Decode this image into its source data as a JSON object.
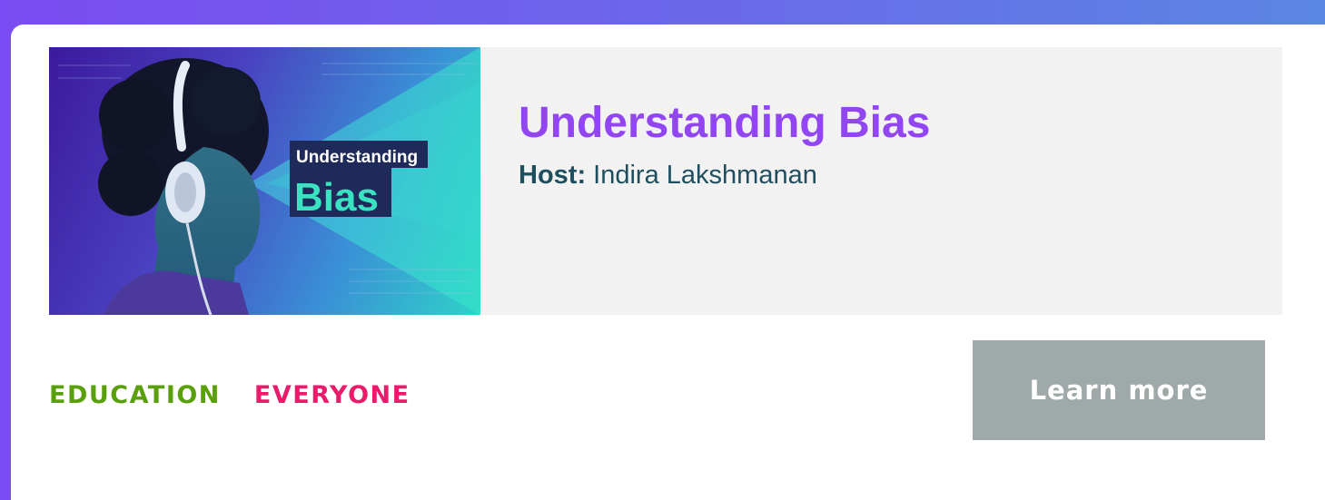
{
  "podcast": {
    "title": "Understanding Bias",
    "host_label": "Host:",
    "host_name": "Indira Lakshmanan",
    "artwork": {
      "line1": "Understanding",
      "line2": "Bias"
    }
  },
  "tags": {
    "education": "EDUCATION",
    "everyone": "EVERYONE"
  },
  "cta": {
    "label": "Learn more"
  },
  "colors": {
    "title": "#9146f2",
    "host": "#1f4e5f",
    "education": "#5a9f0c",
    "everyone": "#ea1b6b",
    "button": "#9fa9a9"
  }
}
